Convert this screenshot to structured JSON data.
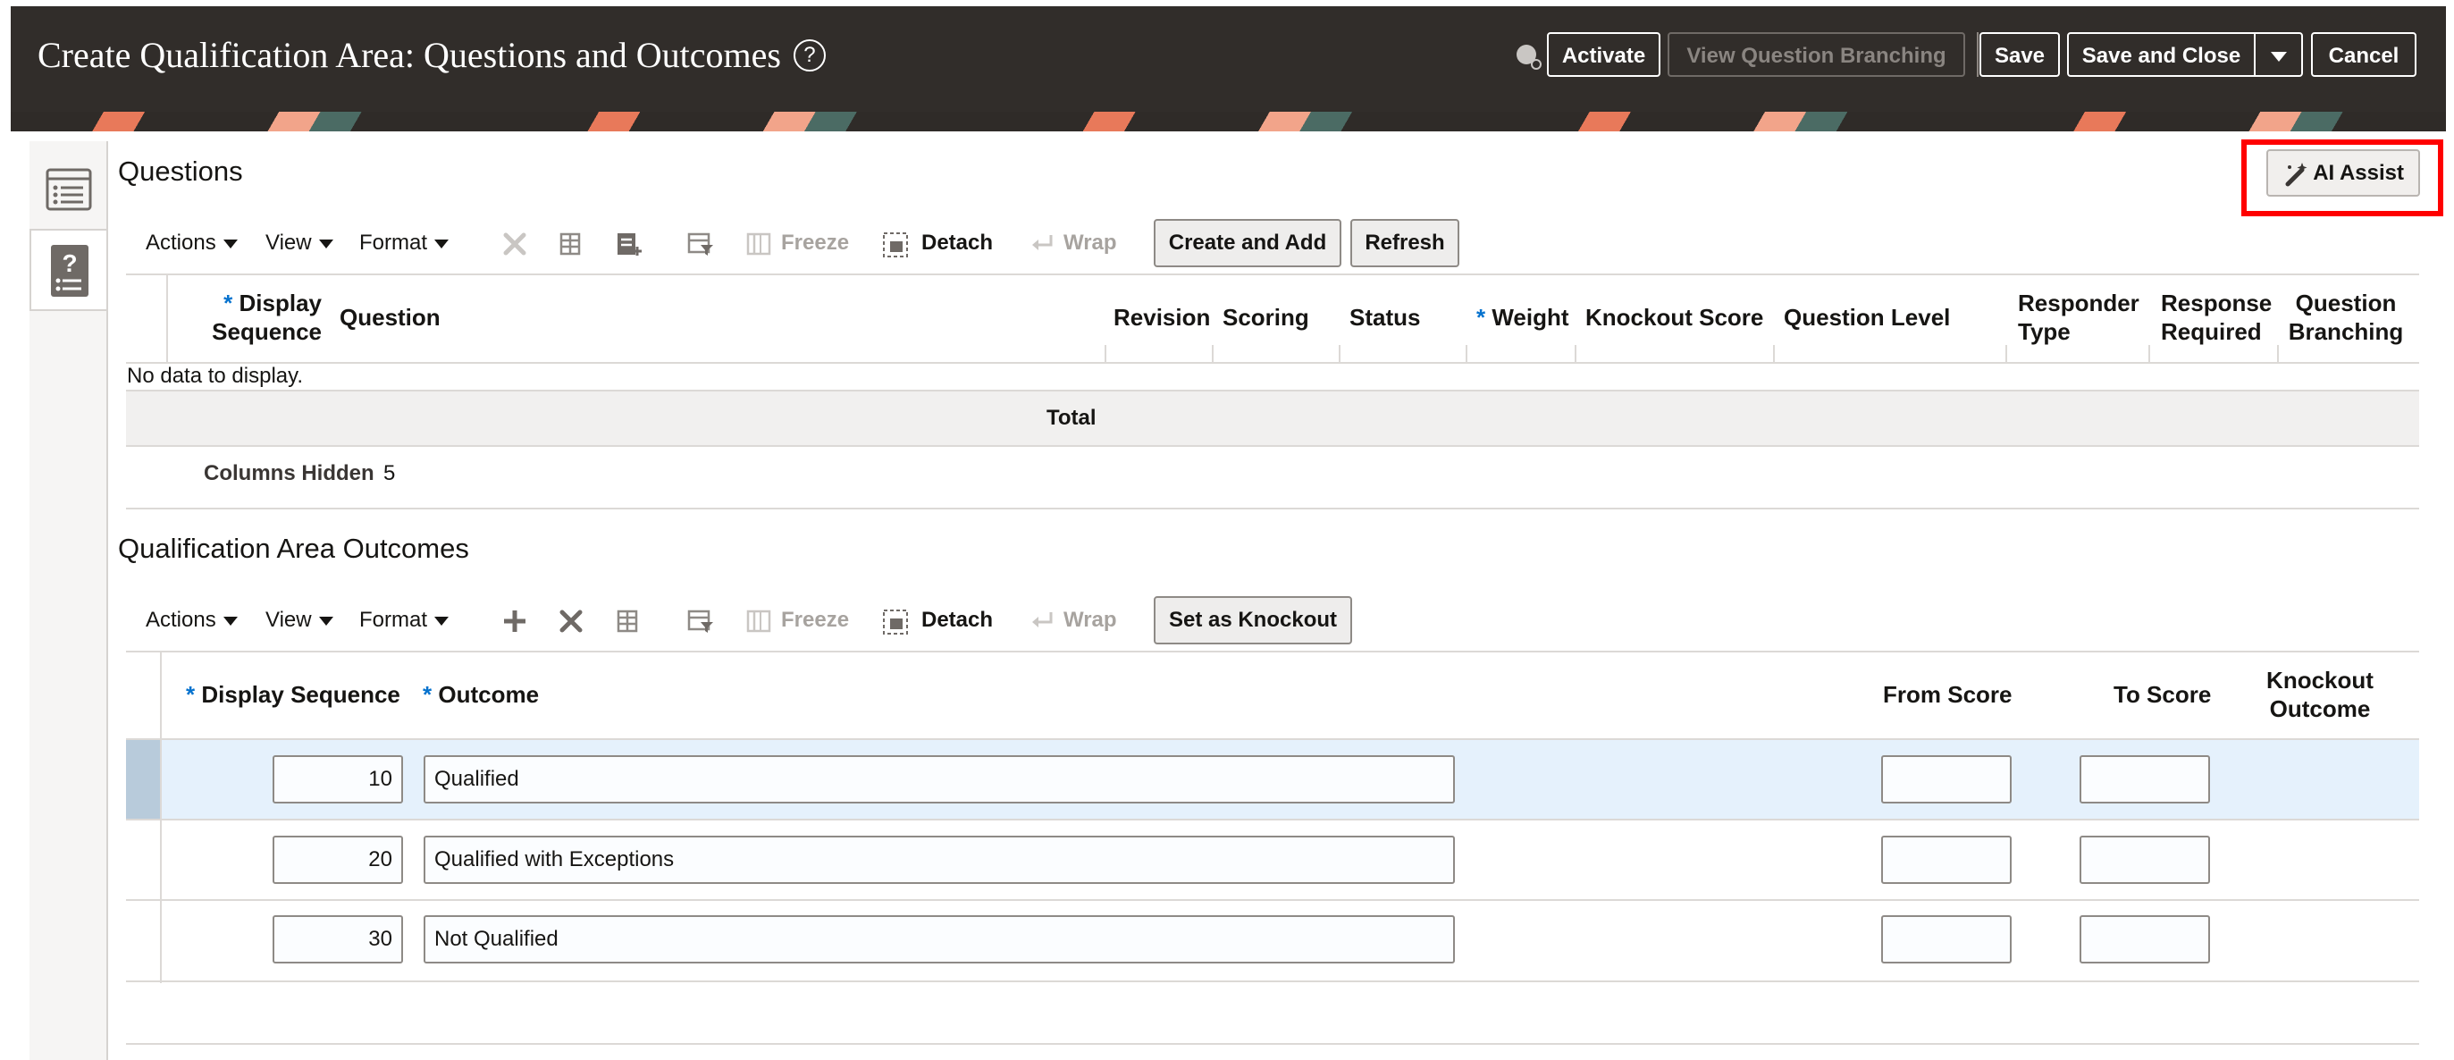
{
  "header": {
    "title": "Create Qualification Area: Questions and Outcomes",
    "help_glyph": "?",
    "activate_label": "Activate",
    "view_branching_label": "View Question Branching",
    "save_label": "Save",
    "save_and_close_label": "Save and Close",
    "cancel_label": "Cancel",
    "icons": [
      "globe-icon",
      "help-icon",
      "chevron-down-icon"
    ]
  },
  "questions": {
    "title": "Questions",
    "ai_assist_label": "AI Assist",
    "toolbar": {
      "actions": "Actions",
      "view": "View",
      "format": "Format",
      "freeze": "Freeze",
      "detach": "Detach",
      "wrap": "Wrap",
      "create_and_add": "Create and Add",
      "refresh": "Refresh"
    },
    "columns": {
      "display_sequence_1": "Display",
      "display_sequence_2": "Sequence",
      "question": "Question",
      "revision": "Revision",
      "scoring": "Scoring",
      "status": "Status",
      "weight": "Weight",
      "knockout_score": "Knockout Score",
      "question_level": "Question Level",
      "responder_type_1": "Responder",
      "responder_type_2": "Type",
      "response_required_1": "Response",
      "response_required_2": "Required",
      "question_branching_1": "Question",
      "question_branching_2": "Branching"
    },
    "required_marker": "*",
    "empty_message": "No data to display.",
    "total_label": "Total",
    "columns_hidden_label": "Columns Hidden",
    "columns_hidden_count": "5"
  },
  "outcomes": {
    "title": "Qualification Area Outcomes",
    "toolbar": {
      "actions": "Actions",
      "view": "View",
      "format": "Format",
      "freeze": "Freeze",
      "detach": "Detach",
      "wrap": "Wrap",
      "set_as_knockout": "Set as Knockout"
    },
    "columns": {
      "display_sequence": "Display Sequence",
      "outcome": "Outcome",
      "from_score": "From Score",
      "to_score": "To Score",
      "knockout_outcome_1": "Knockout",
      "knockout_outcome_2": "Outcome"
    },
    "required_marker": "*",
    "rows": [
      {
        "sequence": "10",
        "outcome": "Qualified",
        "from_score": "",
        "to_score": ""
      },
      {
        "sequence": "20",
        "outcome": "Qualified with Exceptions",
        "from_score": "",
        "to_score": ""
      },
      {
        "sequence": "30",
        "outcome": "Not Qualified",
        "from_score": "",
        "to_score": ""
      }
    ]
  },
  "colors": {
    "header_bg": "#312d2a",
    "required_asterisk": "#0572ce",
    "selected_row": "#e5f1fc",
    "highlight": "#ff0000"
  }
}
